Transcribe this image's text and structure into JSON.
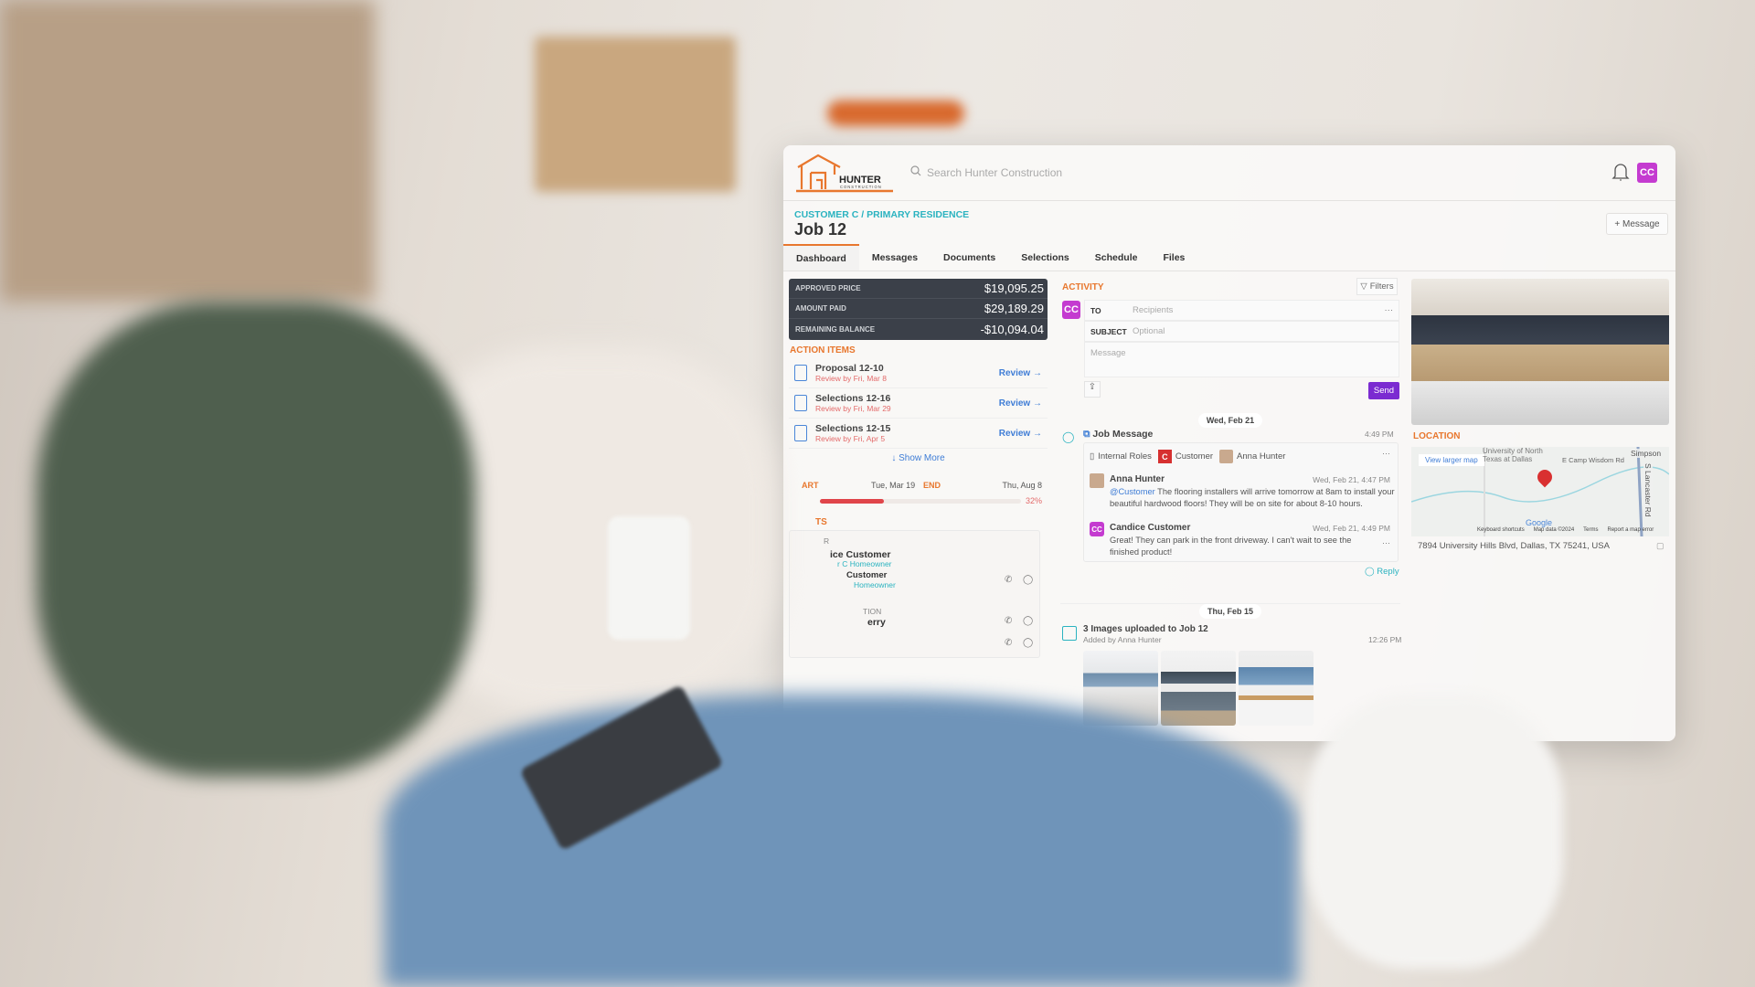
{
  "header": {
    "brand": "HUNTER",
    "brand_sub": "CONSTRUCTION",
    "search_placeholder": "Search Hunter Construction",
    "avatar": "CC",
    "icons": [
      "search-icon",
      "bell-icon"
    ]
  },
  "job": {
    "breadcrumb": "CUSTOMER C / PRIMARY RESIDENCE",
    "title": "Job 12",
    "message_button": "+ Message"
  },
  "tabs": [
    {
      "label": "Dashboard",
      "active": true
    },
    {
      "label": "Messages"
    },
    {
      "label": "Documents"
    },
    {
      "label": "Selections"
    },
    {
      "label": "Schedule"
    },
    {
      "label": "Files"
    }
  ],
  "summary": [
    {
      "label": "APPROVED PRICE",
      "value": "$19,095.25"
    },
    {
      "label": "AMOUNT PAID",
      "value": "$29,189.29"
    },
    {
      "label": "REMAINING BALANCE",
      "value": "-$10,094.04"
    }
  ],
  "action_items": {
    "label": "ACTION ITEMS",
    "items": [
      {
        "title": "Proposal 12-10",
        "due": "Review by Fri, Mar 8",
        "action": "Review →"
      },
      {
        "title": "Selections 12-16",
        "due": "Review by Fri, Mar 29",
        "action": "Review →"
      },
      {
        "title": "Selections 12-15",
        "due": "Review by Fri, Apr 5",
        "action": "Review →"
      }
    ],
    "show_more": "↓ Show More"
  },
  "schedule": {
    "start_label": "ART",
    "start": "Tue, Mar 19",
    "end_label": "END",
    "end": "Thu, Aug 8",
    "progress_percent": 32,
    "progress_label": "32%",
    "bar_color": "#e0454a"
  },
  "contacts": {
    "label": "TS",
    "group1": "R",
    "c1_name": "ice Customer",
    "c1_role": "r C Homeowner",
    "c2_name": "Customer",
    "c2_role": "Homeowner",
    "group2": "TION",
    "c3_name": "erry"
  },
  "activity": {
    "label": "ACTIVITY",
    "filters": "Filters",
    "composer": {
      "avatar": "CC",
      "to_label": "TO",
      "to_placeholder": "Recipients",
      "subject_label": "SUBJECT",
      "subject_placeholder": "Optional",
      "message_placeholder": "Message",
      "send": "Send",
      "more": "···"
    },
    "date1": "Wed, Feb 21",
    "thread": {
      "title": "Job Message",
      "time": "4:49 PM",
      "recipients": [
        "Internal Roles",
        "Customer",
        "Anna Hunter"
      ],
      "customer_badge": "C",
      "messages": [
        {
          "author": "Anna Hunter",
          "time": "Wed, Feb 21, 4:47 PM",
          "mention": "@Customer",
          "text": " The flooring installers will arrive tomorrow at 8am to install your beautiful hardwood floors! They will be on site for about 8-10 hours."
        },
        {
          "author": "Candice Customer",
          "avatar": "CC",
          "time": "Wed, Feb 21, 4:49 PM",
          "text": "Great! They can park in the front driveway. I can't wait to see the finished product!"
        }
      ],
      "reply": "Reply"
    },
    "date2": "Thu, Feb 15",
    "upload": {
      "title": "3 Images uploaded to Job 12",
      "sub": "Added by Anna Hunter",
      "time": "12:26 PM"
    }
  },
  "location": {
    "label": "LOCATION",
    "view_larger": "View larger map",
    "map_labels": [
      "University of North Texas at Dallas",
      "E Camp Wisdom Rd",
      "Simpson",
      "S Lancaster Rd"
    ],
    "google": "Google",
    "footer": [
      "Keyboard shortcuts",
      "Map data ©2024",
      "Terms",
      "Report a map error"
    ],
    "address": "7894 University Hills Blvd, Dallas, TX 75241, USA",
    "pin_color": "#d93030"
  },
  "colors": {
    "accent": "#e8772e",
    "teal": "#2bb3c0",
    "purple": "#7b2bd1",
    "avatar": "#c43bd0",
    "summary_bg": "#3b4049",
    "link": "#3f7dd6"
  }
}
